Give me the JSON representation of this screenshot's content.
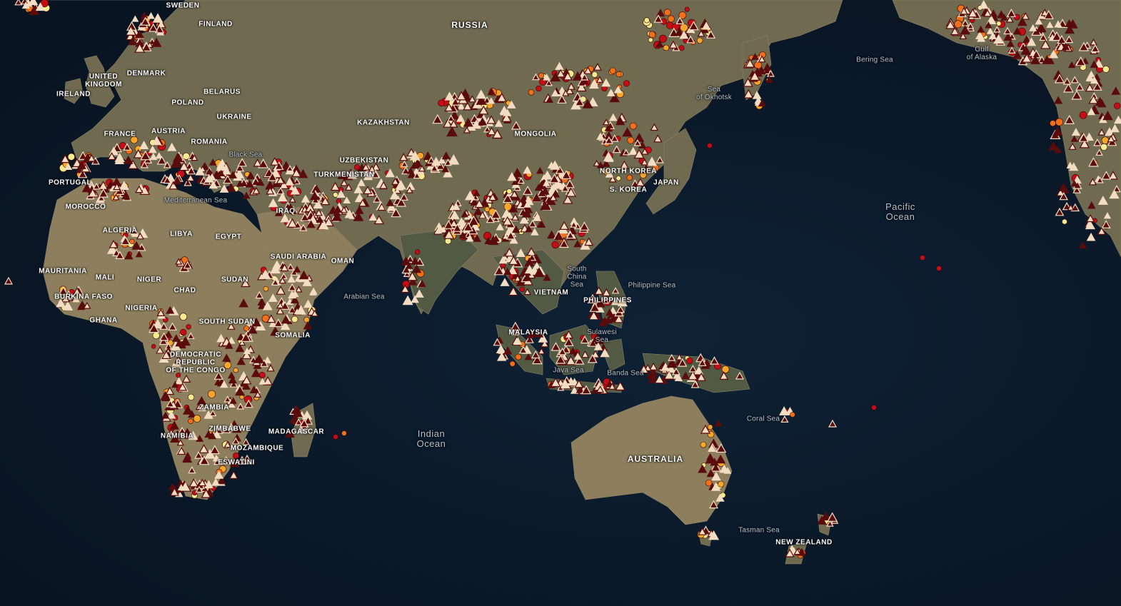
{
  "colors": {
    "ocean": "#0a1726",
    "land": "#6f6a50",
    "triangle_fill": "#f2dcc2",
    "triangle_stroke": "#5a0c0c",
    "point_red": "#c40d16",
    "point_orange": "#ef6f1a",
    "point_amber": "#f4a72b",
    "point_yellow": "#f7eb8f"
  },
  "icons": {
    "hazard_marker": "triangle-icon",
    "point_marker": "circle-icon",
    "star_marker": "star-icon"
  },
  "labels": {
    "sweden": "SWEDEN",
    "finland": "FINLAND",
    "russia": "RUSSIA",
    "united_kingdom": "UNITED\nKINGDOM",
    "ireland": "IRELAND",
    "denmark": "DENMARK",
    "poland": "POLAND",
    "belarus": "BELARUS",
    "ukraine": "UKRAINE",
    "kazakhstan": "KAZAKHSTAN",
    "uzbekistan": "UZBEKISTAN",
    "turkmenistan": "TURKMENISTAN",
    "france": "FRANCE",
    "austria": "AUSTRIA",
    "romania": "ROMANIA",
    "portugal": "PORTUGAL",
    "morocco": "MOROCCO",
    "algeria": "ALGERIA",
    "libya": "LIBYA",
    "egypt": "EGYPT",
    "iraq": "IRAQ",
    "saudi_arabia": "SAUDI ARABIA",
    "oman": "OMAN",
    "mauritania": "MAURITANIA",
    "mali": "MALI",
    "niger": "NIGER",
    "chad": "CHAD",
    "sudan": "SUDAN",
    "south_sudan": "SOUTH SUDAN",
    "burkina_faso": "BURKINA FASO",
    "nigeria": "NIGERIA",
    "ghana": "GHANA",
    "somalia": "SOMALIA",
    "drc": "DEMOCRATIC\nREPUBLIC\nOF THE CONGO",
    "zambia": "ZAMBIA",
    "zimbabwe": "ZIMBABWE",
    "namibia": "NAMIBIA",
    "mozambique": "MOZAMBIQUE",
    "eswatini": "ESWATINI",
    "madagascar": "MADAGASCAR",
    "mongolia": "MONGOLIA",
    "north_korea": "NORTH KOREA",
    "south_korea": "S. KOREA",
    "japan": "JAPAN",
    "philippines": "PHILIPPINES",
    "malaysia": "MALAYSIA",
    "vietnam": "VIETNAM",
    "australia": "AUSTRALIA",
    "new_zealand": "NEW ZEALAND"
  },
  "seas": {
    "black_sea": "Black Sea",
    "mediterranean": "Mediterranean Sea",
    "arabian_sea": "Arabian Sea",
    "south_china_sea": "South\nChina\nSea",
    "philippine_sea": "Philippine Sea",
    "sulawesi_sea": "Sulawesi\nSea",
    "java_sea": "Java Sea",
    "banda_sea": "Banda Sea",
    "coral_sea": "Coral Sea",
    "tasman_sea": "Tasman Sea",
    "sea_of_okhotsk": "Sea\nof Okhotsk",
    "bering_sea": "Bering Sea",
    "gulf_of_alaska": "Gulf\nof Alaska"
  },
  "oceans": {
    "indian_ocean": "Indian\nOcean",
    "pacific_ocean": "Pacific\nOcean"
  }
}
